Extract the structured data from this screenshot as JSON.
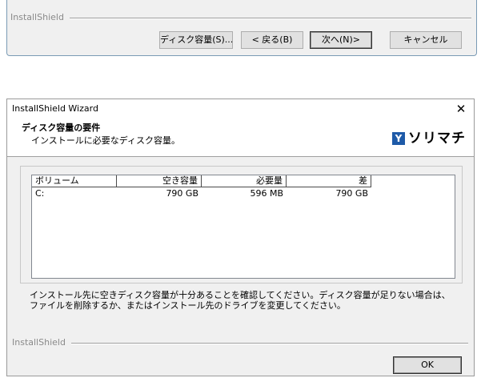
{
  "top_panel": {
    "brand": "InstallShield",
    "buttons": {
      "disk_space": "ディスク容量(S)...",
      "back": "< 戻る(B)",
      "next": "次へ(N)>",
      "cancel": "キャンセル"
    }
  },
  "dialog": {
    "title": "InstallShield Wizard",
    "close_glyph": "✕",
    "header": {
      "title": "ディスク容量の要件",
      "subtitle": "インストールに必要なディスク容量。",
      "logo_mark": "Y",
      "logo_text": "ソリマチ",
      "logo_color": "#1e5aa8"
    },
    "table": {
      "columns": [
        "ボリューム",
        "空き容量",
        "必要量",
        "差"
      ],
      "rows": [
        [
          "C:",
          "790 GB",
          "596 MB",
          "790 GB"
        ]
      ]
    },
    "info_text": "インストール先に空きディスク容量が十分あることを確認してください。ディスク容量が足りない場合は、ファイルを削除するか、またはインストール先のドライブを変更してください。",
    "footer_brand": "InstallShield",
    "ok_button": "OK"
  }
}
